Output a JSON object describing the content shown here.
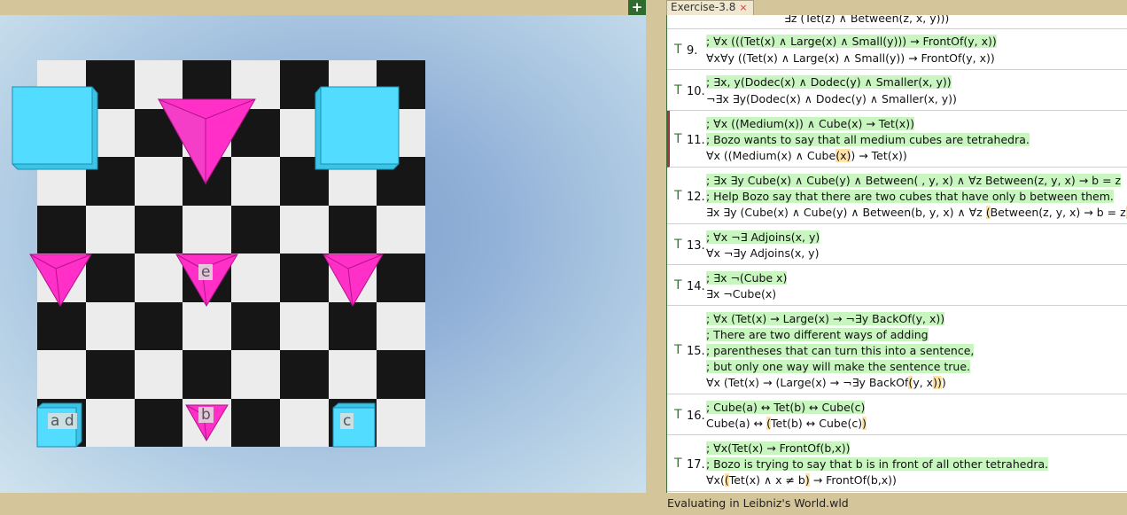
{
  "tab": {
    "title": "Exercise-3.8",
    "close": "×"
  },
  "toolbar": {
    "add": "+"
  },
  "board": {
    "labels": {
      "a_d": "a d",
      "b": "b",
      "c": "c",
      "e": "e"
    }
  },
  "sentences": [
    {
      "partial": "∃z (Tet(z) ∧ Between(z, x, y)))"
    },
    {
      "truth": "T",
      "num": "9.",
      "comments": [
        "; ∀x (((Tet(x) ∧ Large(x) ∧ Small(y))) → FrontOf(y, x))"
      ],
      "formula": "∀x∀y ((Tet(x) ∧ Large(x) ∧ Small(y)) → FrontOf(y, x))"
    },
    {
      "truth": "T",
      "num": "10.",
      "comments": [
        "; ∃x, y(Dodec(x) ∧ Dodec(y) ∧ Smaller(x, y))"
      ],
      "formula": "¬∃x ∃y(Dodec(x) ∧ Dodec(y) ∧ Smaller(x, y))"
    },
    {
      "truth": "T",
      "num": "11.",
      "comments": [
        "; ∀x ((Medium(x)) ∧ Cube(x) → Tet(x))",
        "; Bozo wants to say that all medium cubes are tetrahedra."
      ],
      "formula_parts": [
        "∀x ((Medium(x) ∧ Cube",
        "(x)",
        ") → Tet(x))"
      ]
    },
    {
      "truth": "T",
      "num": "12.",
      "comments": [
        "; ∃x ∃y Cube(x) ∧ Cube(y) ∧ Between( , y, x)  ∧ ∀z Between(z, y, x) → b = z",
        "; Help Bozo say that there are two cubes that have only b between them."
      ],
      "formula_parts": [
        "∃x ∃y (Cube(x) ∧ Cube(y) ∧ Between(b, y, x) ∧ ∀z ",
        "(",
        "Between(z, y, x) → b = z",
        ")",
        ")"
      ]
    },
    {
      "truth": "T",
      "num": "13.",
      "comments": [
        "; ∀x ¬∃ Adjoins(x, y)"
      ],
      "formula": "∀x ¬∃y Adjoins(x, y)"
    },
    {
      "truth": "T",
      "num": "14.",
      "comments": [
        "; ∃x ¬(Cube x)"
      ],
      "formula": "∃x ¬Cube(x)"
    },
    {
      "truth": "T",
      "num": "15.",
      "comments": [
        "; ∀x (Tet(x) → Large(x) → ¬∃y BackOf(y, x))",
        "; There are two different ways of adding ",
        "; parentheses that can turn this into a sentence,",
        "; but only one way will make the sentence true."
      ],
      "formula_parts": [
        "∀x (Tet(x) → (Large(x) → ¬∃y BackOf",
        "(",
        "y, x",
        ")",
        ")",
        ")"
      ]
    },
    {
      "truth": "T",
      "num": "16.",
      "comments": [
        "; Cube(a) ↔ Tet(b) ↔ Cube(c)"
      ],
      "formula_parts": [
        "Cube(a) ↔ ",
        "(",
        "Tet(b) ↔ Cube(c)",
        ")"
      ]
    },
    {
      "truth": "T",
      "num": "17.",
      "comments": [
        "; ∀x(Tet(x) → FrontOf(b,x))",
        "; Bozo is trying to say that b is in front of all other tetrahedra."
      ],
      "formula_parts": [
        "∀x(",
        "(",
        "Tet(x) ∧ x ≠ b",
        ")",
        " → FrontOf(b,x))"
      ]
    }
  ],
  "status": "Evaluating in Leibniz's World.wld",
  "colors": {
    "cube": "#52dcff",
    "tet": "#ff2fc8",
    "comment_bg": "#c8f5c0",
    "paren_bg": "#ffe2a8"
  }
}
